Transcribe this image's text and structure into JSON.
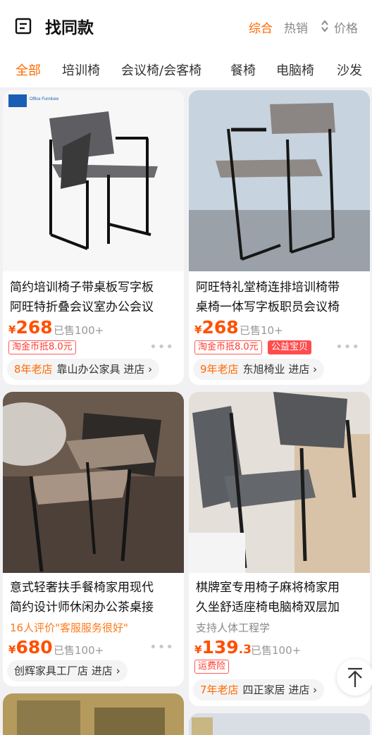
{
  "header": {
    "title": "找同款",
    "sort_comprehensive": "综合",
    "sort_hot": "热销",
    "sort_price": "价格"
  },
  "categories": [
    "全部",
    "培训椅",
    "会议椅/会客椅",
    "餐椅",
    "电脑椅",
    "沙发"
  ],
  "colors": {
    "accent": "#ff6a00",
    "price": "#ff5000",
    "tag_red": "#ff3b30"
  },
  "products": [
    {
      "title_line1": "简约培训椅子带桌板写字板",
      "title_line2": "阿旺特折叠会议室办公会议",
      "yen": "¥",
      "price": "268",
      "sold": "已售100+",
      "tag1": "淘金币抵8.0元",
      "shop_age": "8年老店",
      "shop_name": "靠山办公家具 进店",
      "watermark_text": "Office Furniture"
    },
    {
      "title_line1": "阿旺特礼堂椅连排培训椅带",
      "title_line2": "桌椅一体写字板职员会议椅",
      "yen": "¥",
      "price": "268",
      "sold": "已售10+",
      "tag1": "淘金币抵8.0元",
      "tag2": "公益宝贝",
      "shop_age": "9年老店",
      "shop_name": "东旭椅业 进店"
    },
    {
      "title_line1": "意式轻奢扶手餐椅家用现代",
      "title_line2": "简约设计师休闲办公茶桌接",
      "review": "16人评价\"客服服务很好\"",
      "yen": "¥",
      "price": "680",
      "sold": "已售100+",
      "shop_name": "创辉家具工厂店 进店"
    },
    {
      "title_line1": "棋牌室专用椅子麻将椅家用",
      "title_line2": "久坐舒适座椅电脑椅双层加",
      "feature": "支持人体工程学",
      "yen": "¥",
      "price": "139",
      "price_decimal": ".3",
      "sold": "已售100+",
      "tag1": "运费险",
      "shop_age": "7年老店",
      "shop_name": "四正家居 进店"
    }
  ],
  "more_dots": "•••"
}
